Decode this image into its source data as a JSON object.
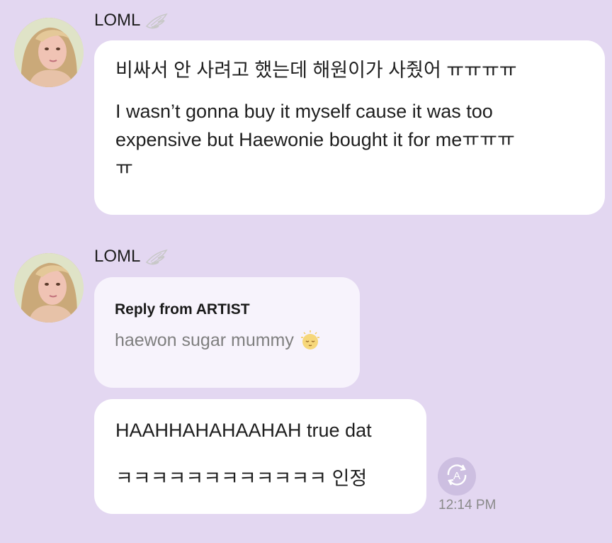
{
  "messages": [
    {
      "sender": "LOML",
      "text_lines": [
        "비싸서 안 사려고 했는데 해원이가 사줬어 ㅠㅠㅠㅠ",
        "I wasn’t gonna buy it myself cause it was too",
        "expensive but Haewonie bought it for meㅠㅠㅠ",
        "ㅠ"
      ]
    },
    {
      "sender": "LOML",
      "reply": {
        "title": "Reply from ARTIST",
        "text": "haewon sugar mummy"
      },
      "text_lines": [
        "HAAHHAHAHAAHAH true dat",
        "ㅋㅋㅋㅋㅋㅋㅋㅋㅋㅋㅋㅋ 인정"
      ],
      "translate_icon": "A",
      "timestamp": "12:14 PM"
    }
  ],
  "colors": {
    "background": "#e3d7f1",
    "bubble": "#ffffff",
    "reply_bubble": "#f7f3fc",
    "translate_button": "#cdbfe1"
  },
  "icons": [
    "wing-icon",
    "sleepy-face-icon",
    "translate-icon"
  ]
}
